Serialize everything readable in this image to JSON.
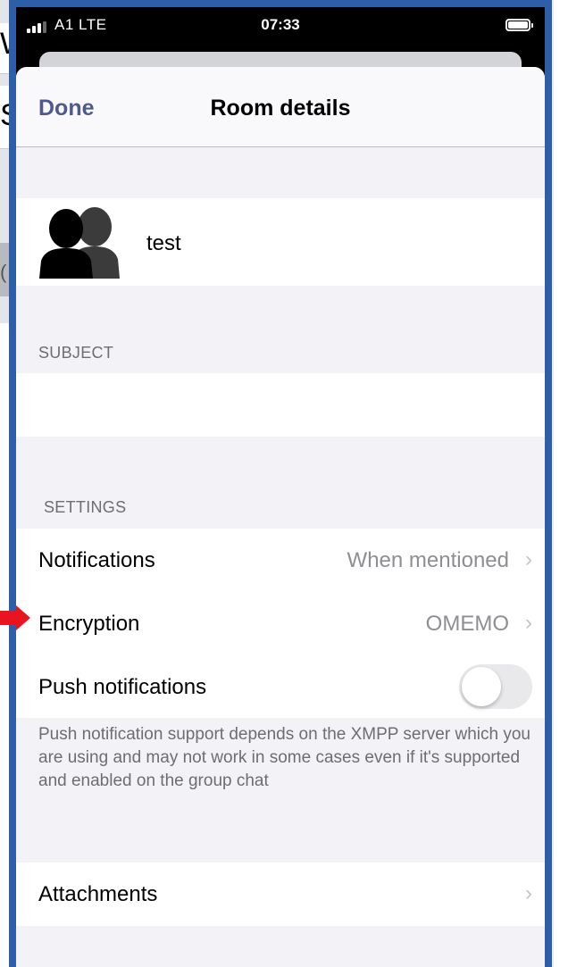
{
  "status_bar": {
    "carrier": "A1  LTE",
    "time": "07:33"
  },
  "background_window": {
    "fragment_1": "W",
    "fragment_2": "S",
    "fragment_3": "("
  },
  "nav": {
    "done_label": "Done",
    "title": "Room details"
  },
  "room": {
    "name": "test",
    "avatar_icon": "group-avatar-icon"
  },
  "subject": {
    "header": "SUBJECT",
    "value": ""
  },
  "settings": {
    "header": "SETTINGS",
    "notifications": {
      "label": "Notifications",
      "value": "When mentioned"
    },
    "encryption": {
      "label": "Encryption",
      "value": "OMEMO"
    },
    "push": {
      "label": "Push notifications",
      "enabled": false
    },
    "footer": "Push notification support depends on the XMPP server which you are using and may not work in some cases even if it's supported and enabled on the group chat"
  },
  "attachments": {
    "label": "Attachments"
  },
  "colors": {
    "accent": "#4f5a8c",
    "frame": "#2f5ea8",
    "annotation_arrow": "#e8141f"
  }
}
